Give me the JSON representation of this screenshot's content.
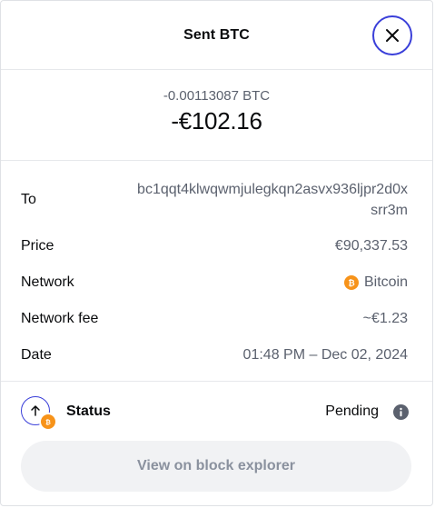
{
  "header": {
    "title": "Sent BTC"
  },
  "amount": {
    "crypto": "-0.00113087 BTC",
    "fiat": "-€102.16"
  },
  "details": {
    "to_label": "To",
    "to_value": "bc1qqt4klwqwmjulegkqn2asvx936ljpr2d0xsrr3m",
    "price_label": "Price",
    "price_value": "€90,337.53",
    "network_label": "Network",
    "network_value": "Bitcoin",
    "fee_label": "Network fee",
    "fee_value": "~€1.23",
    "date_label": "Date",
    "date_value": "01:48 PM – Dec 02, 2024"
  },
  "status": {
    "label": "Status",
    "value": "Pending"
  },
  "explorer_button": {
    "label": "View on block explorer"
  },
  "icons": {
    "close": "close-icon",
    "bitcoin": "bitcoin-icon",
    "arrow_up": "arrow-up-icon",
    "info": "info-icon"
  },
  "colors": {
    "accent": "#3a3fd9",
    "bitcoin": "#f7931a",
    "muted_text": "#5b616e",
    "button_bg": "#f1f2f4"
  }
}
